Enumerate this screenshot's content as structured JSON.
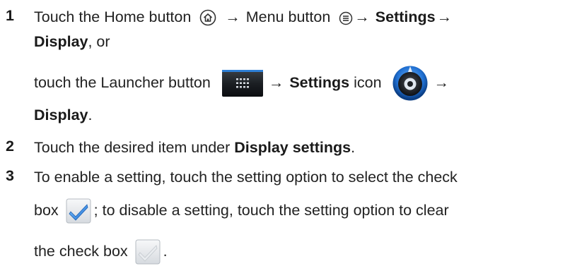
{
  "steps": [
    {
      "num": "1",
      "l1": {
        "pre": "Touch the Home button",
        "arrow1": "→",
        "mid": "Menu button",
        "arrow2": "→",
        "bold1": "Settings",
        "arrow3": "→"
      },
      "l2": {
        "bold": "Display",
        "post": ", or"
      },
      "l3": {
        "pre": "touch the Launcher button",
        "arrow1": "→",
        "bold": "Settings",
        "mid": " icon",
        "arrow2": "→"
      },
      "l4": {
        "bold": "Display",
        "post": "."
      }
    },
    {
      "num": "2",
      "pre": "Touch the desired item under ",
      "bold": "Display settings",
      "post": "."
    },
    {
      "num": "3",
      "l1": "To enable a setting, touch the setting option to select the check",
      "l2": {
        "pre": "box",
        "post": "; to disable a setting, touch the setting option to clear"
      },
      "l3": {
        "pre": "the check box",
        "post": "."
      }
    }
  ],
  "icons": {
    "home": "home-icon",
    "menu": "menu-icon",
    "launcher": "launcher-button-icon",
    "settings": "settings-icon",
    "checkbox_checked": "checked-checkbox-icon",
    "checkbox_unchecked": "unchecked-checkbox-icon"
  },
  "colors": {
    "text": "#222222",
    "check_blue": "#2a86d9",
    "launcher_bar": "#2e7fd6"
  }
}
